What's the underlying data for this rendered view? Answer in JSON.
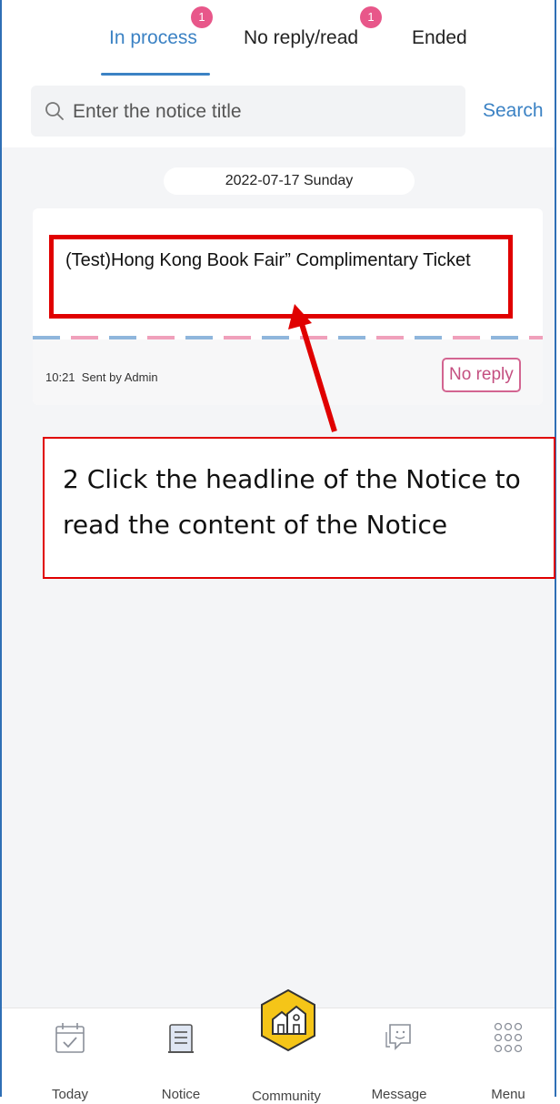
{
  "tabs": [
    {
      "label": "In process",
      "badge": "1",
      "active": true
    },
    {
      "label": "No reply/read",
      "badge": "1",
      "active": false
    },
    {
      "label": "Ended",
      "badge": "",
      "active": false
    }
  ],
  "search": {
    "placeholder": "Enter the notice title",
    "button_label": "Search"
  },
  "date_label": "2022-07-17 Sunday",
  "notice": {
    "title": "(Test)Hong Kong Book Fair” Complimentary Ticket",
    "time": "10:21",
    "sender": "Sent by Admin",
    "status": "No reply"
  },
  "annotation": {
    "line1": "2 Click the headline of the Notice to",
    "line2": "read the content of the Notice"
  },
  "nav": [
    {
      "label": "Today",
      "icon": "calendar-check-icon"
    },
    {
      "label": "Notice",
      "icon": "document-icon"
    },
    {
      "label": "Community",
      "icon": "community-houses-icon"
    },
    {
      "label": "Message",
      "icon": "chat-bubble-icon"
    },
    {
      "label": "Menu",
      "icon": "grid-dots-icon"
    }
  ],
  "colors": {
    "accent": "#3b82c4",
    "badge": "#e8578a",
    "status": "#c44f80",
    "annotation_red": "#e00000",
    "frame_blue": "#2f6fb5"
  }
}
